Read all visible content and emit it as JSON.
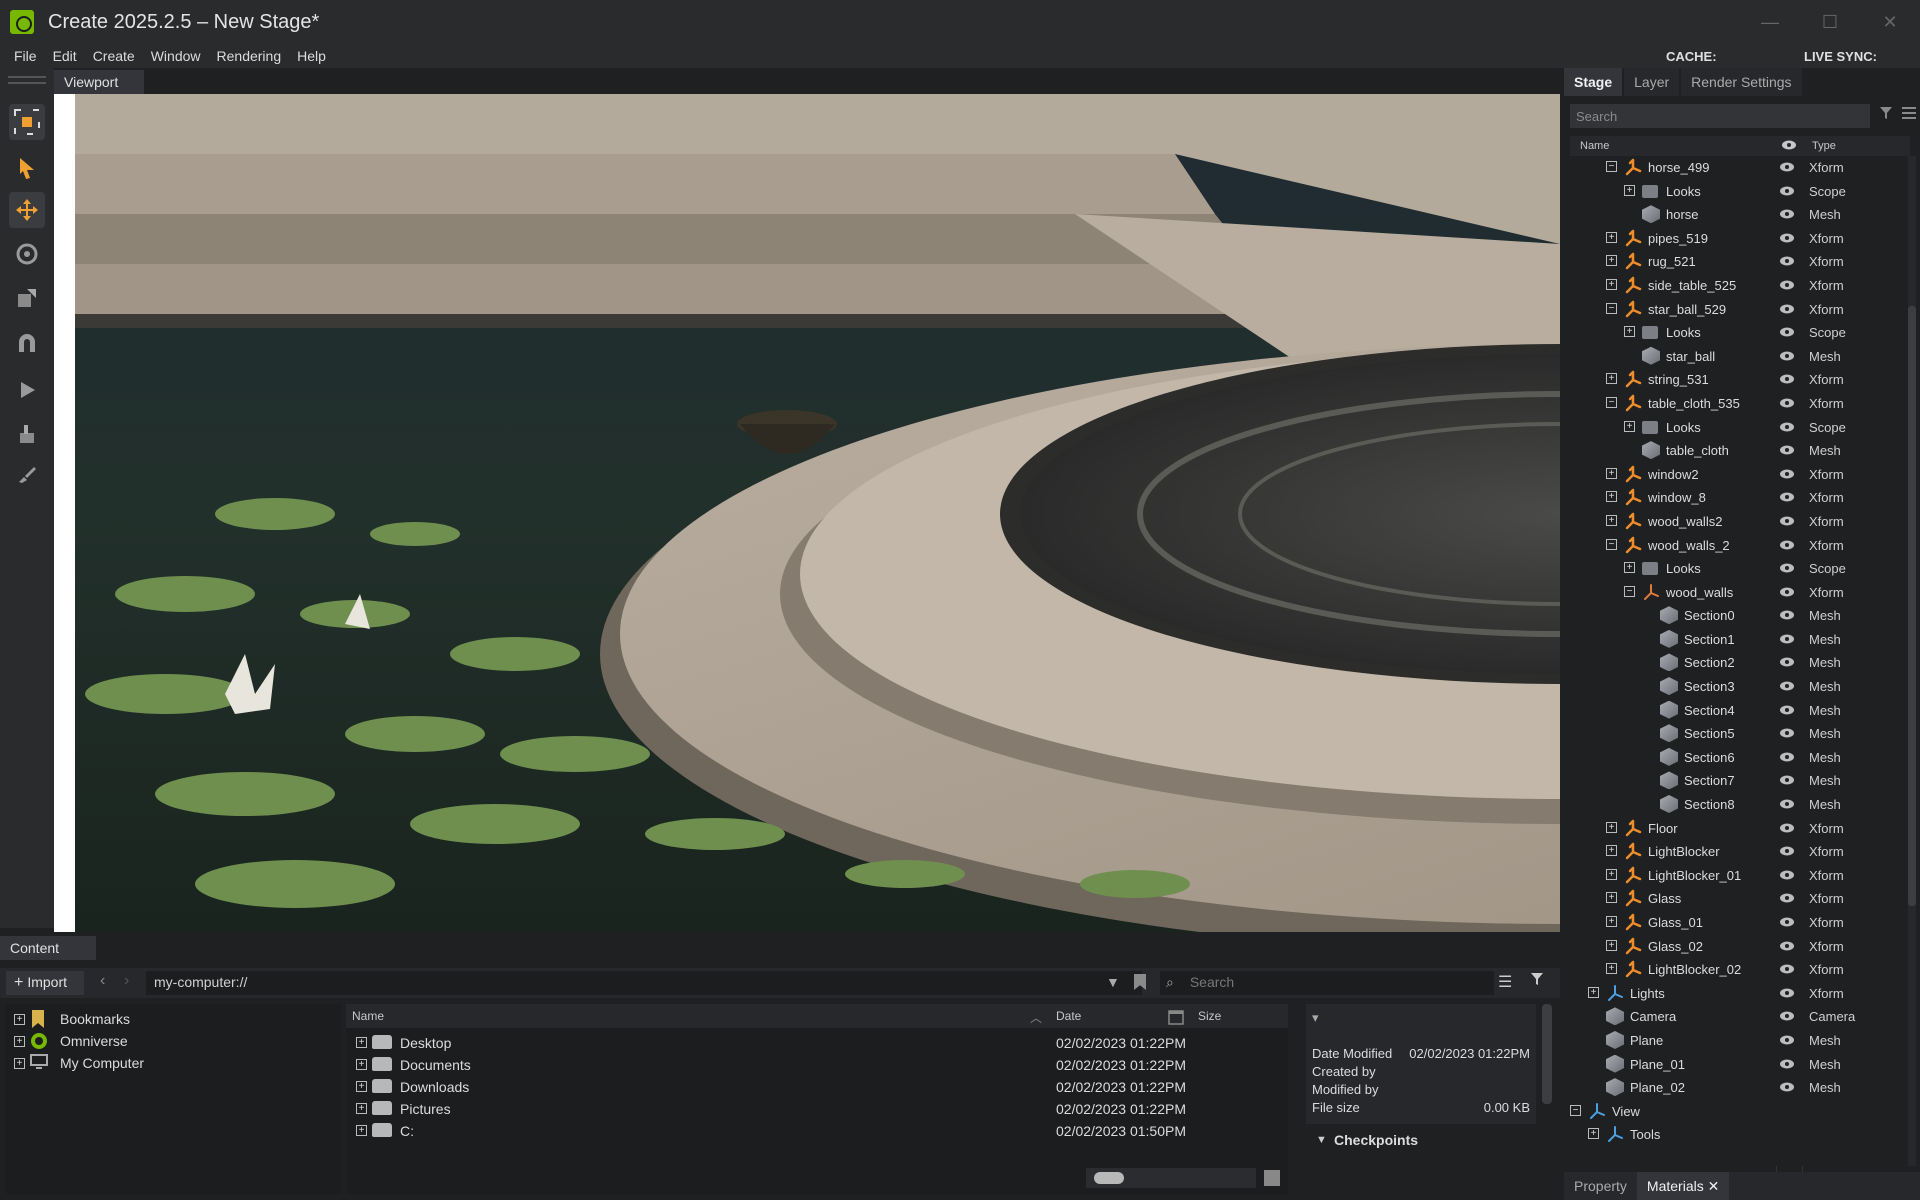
{
  "window": {
    "title": "Create 2025.2.5 – New Stage*",
    "controls": [
      "—",
      "☐",
      "✕"
    ]
  },
  "menubar": {
    "items": [
      "File",
      "Edit",
      "Create",
      "Window",
      "Rendering",
      "Help"
    ],
    "cache_label": "CACHE:",
    "live_sync_label": "LIVE SYNC:"
  },
  "viewport": {
    "tab_label": "Viewport"
  },
  "stage_panel": {
    "tabs": [
      "Stage",
      "Layer",
      "Render Settings"
    ],
    "search_placeholder": "Search",
    "col_name": "Name",
    "col_type": "Type",
    "rows": [
      {
        "name": "horse_499",
        "type": "Xform",
        "icon": "xform",
        "depth": 2,
        "exp": "−"
      },
      {
        "name": "Looks",
        "type": "Scope",
        "icon": "folder",
        "depth": 3,
        "exp": "+"
      },
      {
        "name": "horse",
        "type": "Mesh",
        "icon": "mesh",
        "depth": 3,
        "exp": ""
      },
      {
        "name": "pipes_519",
        "type": "Xform",
        "icon": "xform",
        "depth": 2,
        "exp": "+"
      },
      {
        "name": "rug_521",
        "type": "Xform",
        "icon": "xform",
        "depth": 2,
        "exp": "+"
      },
      {
        "name": "side_table_525",
        "type": "Xform",
        "icon": "xform",
        "depth": 2,
        "exp": "+"
      },
      {
        "name": "star_ball_529",
        "type": "Xform",
        "icon": "xform",
        "depth": 2,
        "exp": "−"
      },
      {
        "name": "Looks",
        "type": "Scope",
        "icon": "folder",
        "depth": 3,
        "exp": "+"
      },
      {
        "name": "star_ball",
        "type": "Mesh",
        "icon": "mesh",
        "depth": 3,
        "exp": ""
      },
      {
        "name": "string_531",
        "type": "Xform",
        "icon": "xform",
        "depth": 2,
        "exp": "+"
      },
      {
        "name": "table_cloth_535",
        "type": "Xform",
        "icon": "xform",
        "depth": 2,
        "exp": "−"
      },
      {
        "name": "Looks",
        "type": "Scope",
        "icon": "folder",
        "depth": 3,
        "exp": "+"
      },
      {
        "name": "table_cloth",
        "type": "Mesh",
        "icon": "mesh",
        "depth": 3,
        "exp": ""
      },
      {
        "name": "window2",
        "type": "Xform",
        "icon": "xform",
        "depth": 2,
        "exp": "+"
      },
      {
        "name": "window_8",
        "type": "Xform",
        "icon": "xform",
        "depth": 2,
        "exp": "+"
      },
      {
        "name": "wood_walls2",
        "type": "Xform",
        "icon": "xform",
        "depth": 2,
        "exp": "+"
      },
      {
        "name": "wood_walls_2",
        "type": "Xform",
        "icon": "xform",
        "depth": 2,
        "exp": "−"
      },
      {
        "name": "Looks",
        "type": "Scope",
        "icon": "folder",
        "depth": 3,
        "exp": "+"
      },
      {
        "name": "wood_walls",
        "type": "Xform",
        "icon": "xform-plain",
        "depth": 3,
        "exp": "−"
      },
      {
        "name": "Section0",
        "type": "Mesh",
        "icon": "mesh",
        "depth": 4,
        "exp": ""
      },
      {
        "name": "Section1",
        "type": "Mesh",
        "icon": "mesh",
        "depth": 4,
        "exp": ""
      },
      {
        "name": "Section2",
        "type": "Mesh",
        "icon": "mesh",
        "depth": 4,
        "exp": ""
      },
      {
        "name": "Section3",
        "type": "Mesh",
        "icon": "mesh",
        "depth": 4,
        "exp": ""
      },
      {
        "name": "Section4",
        "type": "Mesh",
        "icon": "mesh",
        "depth": 4,
        "exp": ""
      },
      {
        "name": "Section5",
        "type": "Mesh",
        "icon": "mesh",
        "depth": 4,
        "exp": ""
      },
      {
        "name": "Section6",
        "type": "Mesh",
        "icon": "mesh",
        "depth": 4,
        "exp": ""
      },
      {
        "name": "Section7",
        "type": "Mesh",
        "icon": "mesh",
        "depth": 4,
        "exp": ""
      },
      {
        "name": "Section8",
        "type": "Mesh",
        "icon": "mesh",
        "depth": 4,
        "exp": ""
      },
      {
        "name": "Floor",
        "type": "Xform",
        "icon": "xform",
        "depth": 2,
        "exp": "+"
      },
      {
        "name": "LightBlocker",
        "type": "Xform",
        "icon": "xform",
        "depth": 2,
        "exp": "+"
      },
      {
        "name": "LightBlocker_01",
        "type": "Xform",
        "icon": "xform",
        "depth": 2,
        "exp": "+"
      },
      {
        "name": "Glass",
        "type": "Xform",
        "icon": "xform",
        "depth": 2,
        "exp": "+"
      },
      {
        "name": "Glass_01",
        "type": "Xform",
        "icon": "xform",
        "depth": 2,
        "exp": "+"
      },
      {
        "name": "Glass_02",
        "type": "Xform",
        "icon": "xform",
        "depth": 2,
        "exp": "+"
      },
      {
        "name": "LightBlocker_02",
        "type": "Xform",
        "icon": "xform",
        "depth": 2,
        "exp": "+"
      },
      {
        "name": "Lights",
        "type": "Xform",
        "icon": "light",
        "depth": 1,
        "exp": "+"
      },
      {
        "name": "Camera",
        "type": "Camera",
        "icon": "mesh",
        "depth": 1,
        "exp": ""
      },
      {
        "name": "Plane",
        "type": "Mesh",
        "icon": "mesh",
        "depth": 1,
        "exp": ""
      },
      {
        "name": "Plane_01",
        "type": "Mesh",
        "icon": "mesh",
        "depth": 1,
        "exp": ""
      },
      {
        "name": "Plane_02",
        "type": "Mesh",
        "icon": "mesh",
        "depth": 1,
        "exp": ""
      },
      {
        "name": "View",
        "type": "",
        "icon": "light",
        "depth": 0,
        "exp": "−"
      },
      {
        "name": "Tools",
        "type": "",
        "icon": "light",
        "depth": 1,
        "exp": "+"
      }
    ],
    "bottom_tabs": [
      "Property",
      "Materials ✕"
    ]
  },
  "content_panel": {
    "tab_label": "Content",
    "import_label": "Import",
    "path": "my-computer://",
    "search_placeholder": "Search",
    "tree": [
      {
        "label": "Bookmarks",
        "icon": "bookmark"
      },
      {
        "label": "Omniverse",
        "icon": "omniverse"
      },
      {
        "label": "My Computer",
        "icon": "computer"
      }
    ],
    "columns": {
      "name": "Name",
      "date": "Date",
      "size": "Size"
    },
    "files": [
      {
        "name": "Desktop",
        "date": "02/02/2023 01:22PM"
      },
      {
        "name": "Documents",
        "date": "02/02/2023 01:22PM"
      },
      {
        "name": "Downloads",
        "date": "02/02/2023 01:22PM"
      },
      {
        "name": "Pictures",
        "date": "02/02/2023 01:22PM"
      },
      {
        "name": "C:",
        "date": "02/02/2023 01:50PM"
      }
    ],
    "info": {
      "date_modified_label": "Date Modified",
      "date_modified_value": "02/02/2023 01:22PM",
      "created_by_label": "Created by",
      "modified_by_label": "Modified by",
      "file_size_label": "File size",
      "file_size_value": "0.00 KB",
      "checkpoints_label": "Checkpoints"
    }
  },
  "colors": {
    "accent_green": "#76b900",
    "xform_orange": "#f08c2a",
    "light_blue": "#4ca0e0",
    "tool_orange": "#f0a030"
  }
}
